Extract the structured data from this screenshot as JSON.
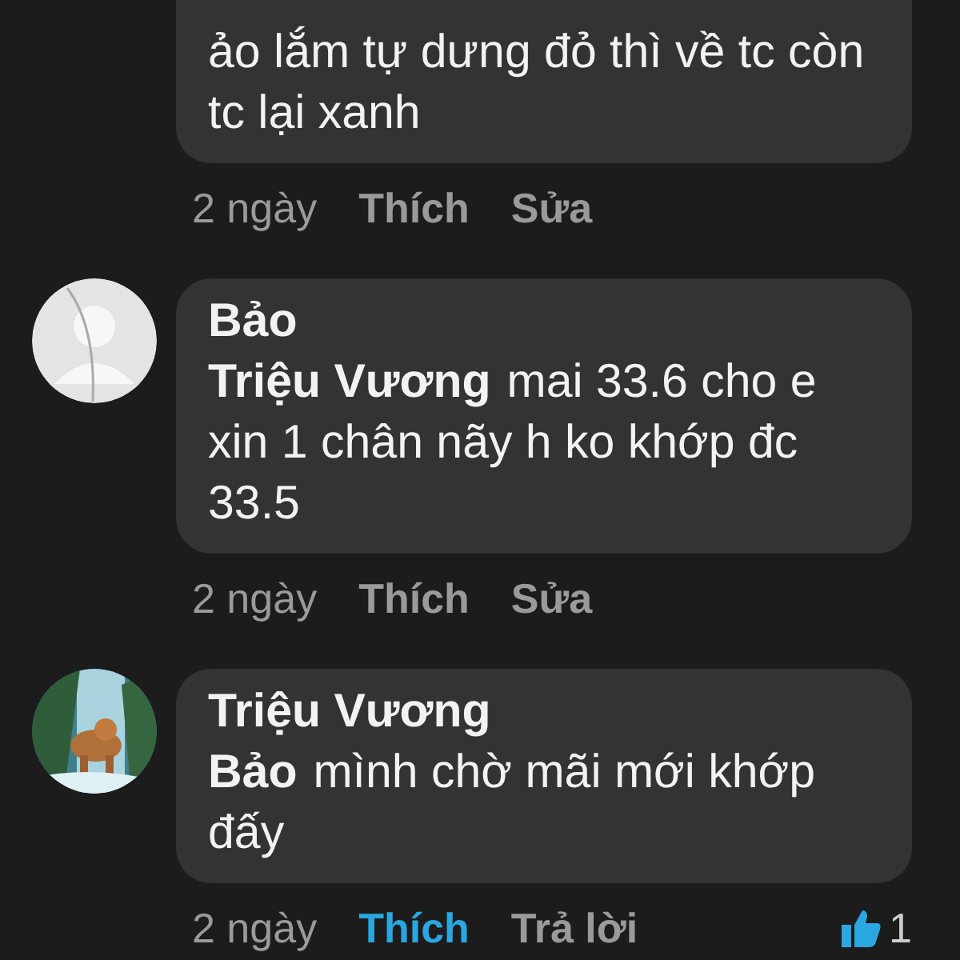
{
  "comments": [
    {
      "kind": "continued",
      "text": "ảo lắm tự dưng đỏ thì về tc còn tc lại xanh",
      "time": "2 ngày",
      "like_label": "Thích",
      "liked": false,
      "action": "Sửa"
    },
    {
      "kind": "placeholder",
      "author": "Bảo",
      "mention": "Triệu Vương",
      "text": "mai 33.6 cho e xin 1 chân nãy h ko khớp đc 33.5",
      "time": "2 ngày",
      "like_label": "Thích",
      "liked": false,
      "action": "Sửa"
    },
    {
      "kind": "picture",
      "author": "Triệu Vương",
      "mention": "Bảo",
      "text": "mình chờ mãi mới khớp đấy",
      "time": "2 ngày",
      "like_label": "Thích",
      "liked": true,
      "action": "Trả lời",
      "likes": "1"
    }
  ]
}
